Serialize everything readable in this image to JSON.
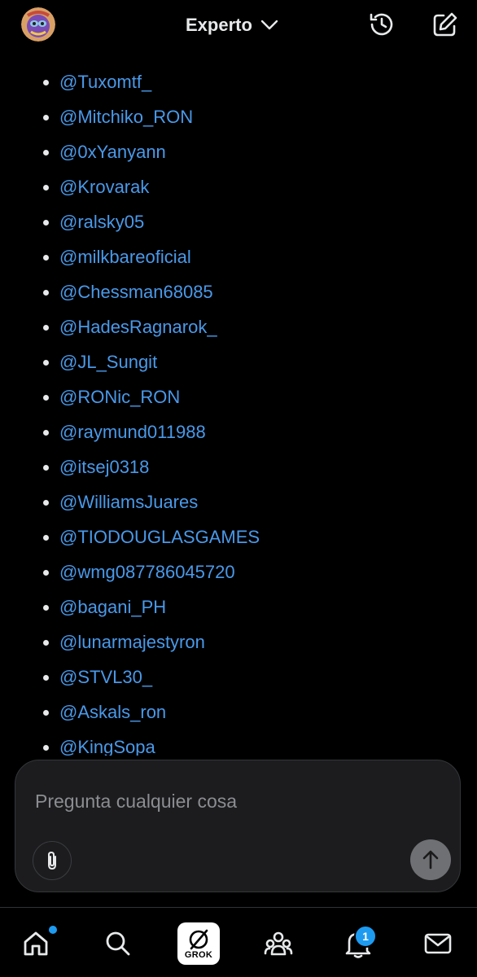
{
  "header": {
    "mode_label": "Experto"
  },
  "mentions": [
    "@Tuxomtf_",
    "@Mitchiko_RON",
    "@0xYanyann",
    "@Krovarak",
    "@ralsky05",
    "@milkbareoficial",
    "@Chessman68085",
    "@HadesRagnarok_",
    "@JL_Sungit",
    "@RONic_RON",
    "@raymund011988",
    "@itsej0318",
    "@WilliamsJuares",
    "@TIODOUGLASGAMES",
    "@wmg087786045720",
    "@bagani_PH",
    "@lunarmajestyron",
    "@STVL30_",
    "@Askals_ron",
    "@KingSopa"
  ],
  "composer": {
    "placeholder": "Pregunta cualquier cosa"
  },
  "bottom_nav": {
    "grok_label": "GROK",
    "notifications_count": "1"
  },
  "colors": {
    "link": "#4a99e9",
    "badge": "#1d9bf0",
    "background": "#000000"
  },
  "icons": [
    "avatar",
    "chevron-down-icon",
    "history-icon",
    "edit-icon",
    "paperclip-icon",
    "arrow-up-icon",
    "home-icon",
    "search-icon",
    "grok-icon",
    "communities-icon",
    "bell-icon",
    "mail-icon"
  ]
}
